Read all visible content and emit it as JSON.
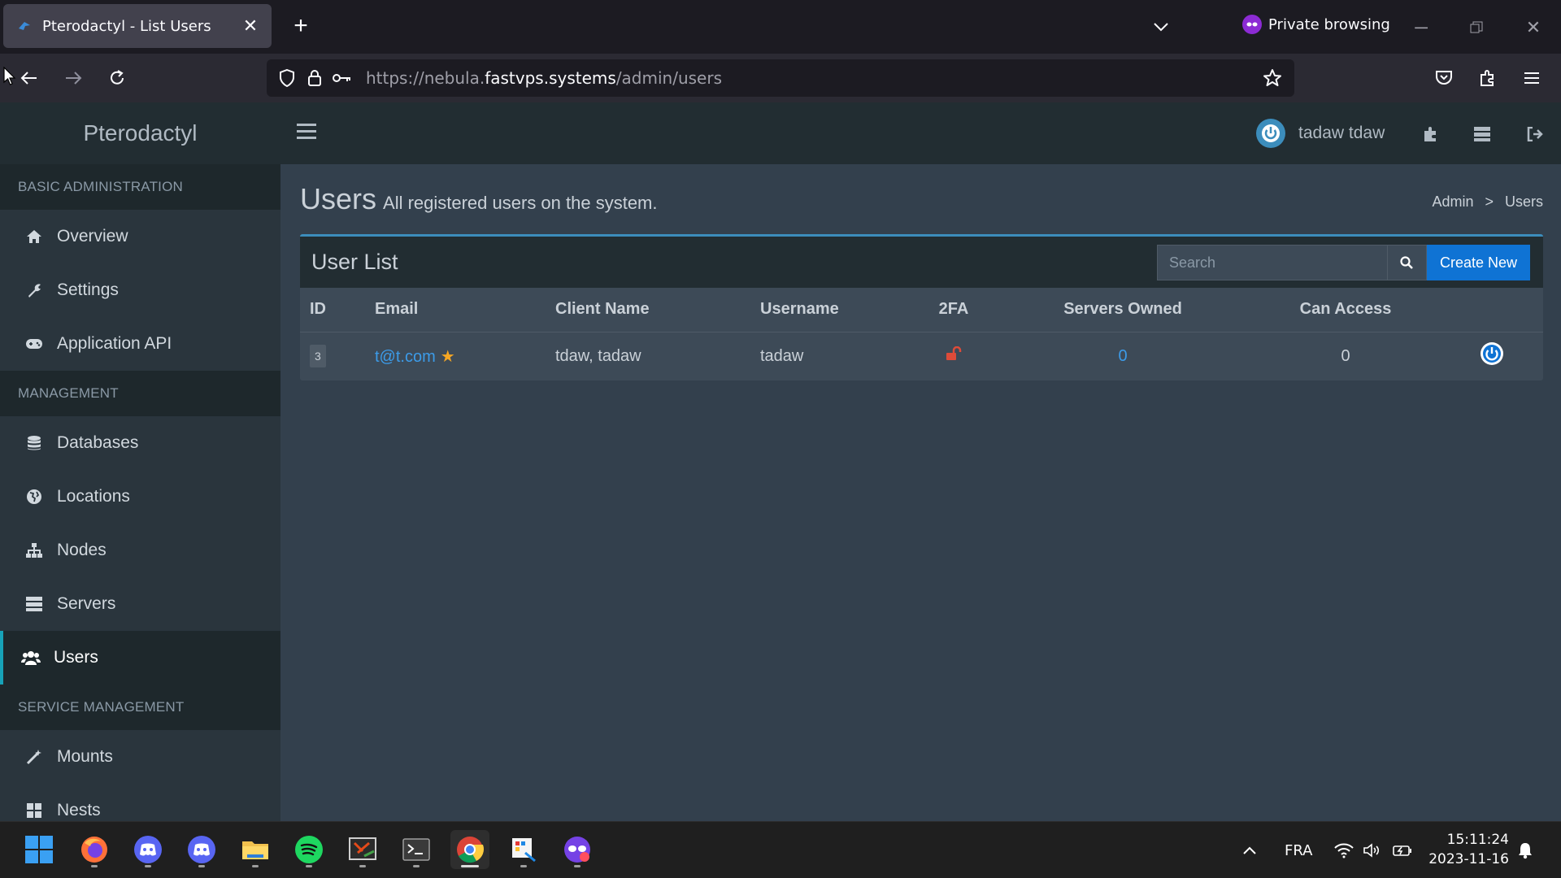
{
  "browser": {
    "tab_title": "Pterodactyl - List Users",
    "url_prefix": "https://nebula.",
    "url_host": "fastvps.systems",
    "url_path": "/admin/users",
    "private_label": "Private browsing"
  },
  "header": {
    "brand": "Pterodactyl",
    "user_name": "tadaw tdaw"
  },
  "sidebar": {
    "sections": [
      {
        "title": "BASIC ADMINISTRATION",
        "items": [
          {
            "label": "Overview",
            "icon": "home-icon"
          },
          {
            "label": "Settings",
            "icon": "wrench-icon"
          },
          {
            "label": "Application API",
            "icon": "gamepad-icon"
          }
        ]
      },
      {
        "title": "MANAGEMENT",
        "items": [
          {
            "label": "Databases",
            "icon": "database-icon"
          },
          {
            "label": "Locations",
            "icon": "globe-icon"
          },
          {
            "label": "Nodes",
            "icon": "sitemap-icon"
          },
          {
            "label": "Servers",
            "icon": "server-icon"
          },
          {
            "label": "Users",
            "icon": "users-icon",
            "active": true
          }
        ]
      },
      {
        "title": "SERVICE MANAGEMENT",
        "items": [
          {
            "label": "Mounts",
            "icon": "magic-icon"
          },
          {
            "label": "Nests",
            "icon": "grid-icon"
          }
        ]
      }
    ]
  },
  "page": {
    "title": "Users",
    "subtitle": "All registered users on the system.",
    "breadcrumb": [
      "Admin",
      "Users"
    ],
    "breadcrumb_sep": ">"
  },
  "user_list": {
    "title": "User List",
    "search_placeholder": "Search",
    "create_label": "Create New",
    "columns": [
      "ID",
      "Email",
      "Client Name",
      "Username",
      "2FA",
      "Servers Owned",
      "Can Access"
    ],
    "rows": [
      {
        "id": "3",
        "email": "t@t.com",
        "client_name": "tdaw, tadaw",
        "username": "tadaw",
        "twofa": "disabled",
        "servers_owned": "0",
        "can_access": "0"
      }
    ]
  },
  "taskbar": {
    "apps": [
      "windows-start-icon",
      "firefox-icon",
      "discord-icon",
      "discord-icon",
      "file-explorer-icon",
      "spotify-icon",
      "snipping-tool-icon",
      "terminal-icon",
      "chrome-icon",
      "paint-icon",
      "firefox-private-icon"
    ],
    "language": "FRA",
    "time": "15:11:24",
    "date": "2023-11-16"
  },
  "colors": {
    "accent": "#3c8dbc",
    "primary_button": "#0f73d4",
    "link": "#3c9be8",
    "active_indicator": "#17a2b8",
    "star": "#f5a623",
    "unlock": "#dd4b39"
  }
}
